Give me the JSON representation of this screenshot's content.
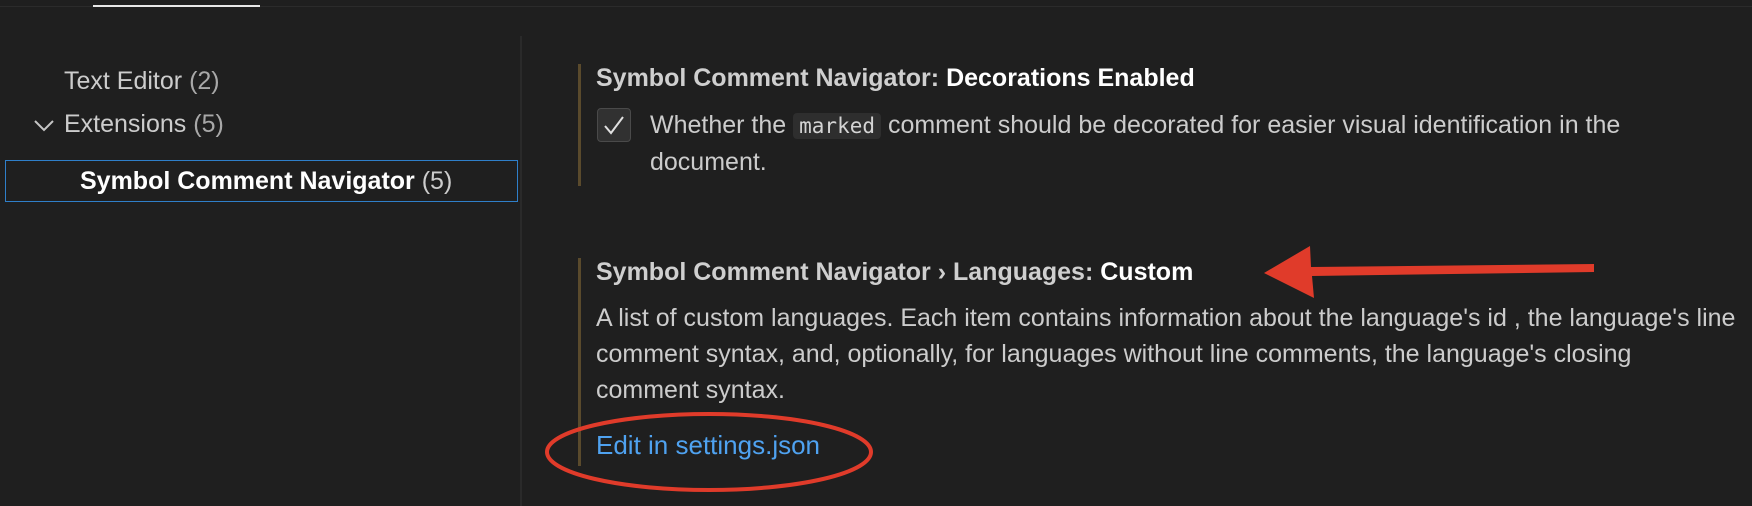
{
  "toc": {
    "items": [
      {
        "label": "Text Editor",
        "count": "(2)"
      },
      {
        "label": "Extensions",
        "count": "(5)"
      }
    ],
    "selected": {
      "label": "Symbol Comment Navigator",
      "count": "(5)"
    }
  },
  "settings": [
    {
      "category": "Symbol Comment Navigator: ",
      "key": "Decorations Enabled",
      "checked": true,
      "desc_before": "Whether the ",
      "desc_code": "marked",
      "desc_after": " comment should be decorated for easier visual identification in the document."
    },
    {
      "category": "Symbol Comment Navigator › Languages: ",
      "key": "Custom",
      "desc": "A list of custom languages. Each item contains information about the language's id , the language's line comment syntax, and, optionally, for languages without line comments, the language's closing comment syntax.",
      "link": "Edit in settings.json"
    }
  ],
  "colors": {
    "background": "#1f1f1f",
    "link": "#4fa2f0",
    "selection_border": "#2f7fc9",
    "annotation": "#e03b2a"
  },
  "icons": [
    "chevron-down-icon",
    "checkmark-icon"
  ]
}
